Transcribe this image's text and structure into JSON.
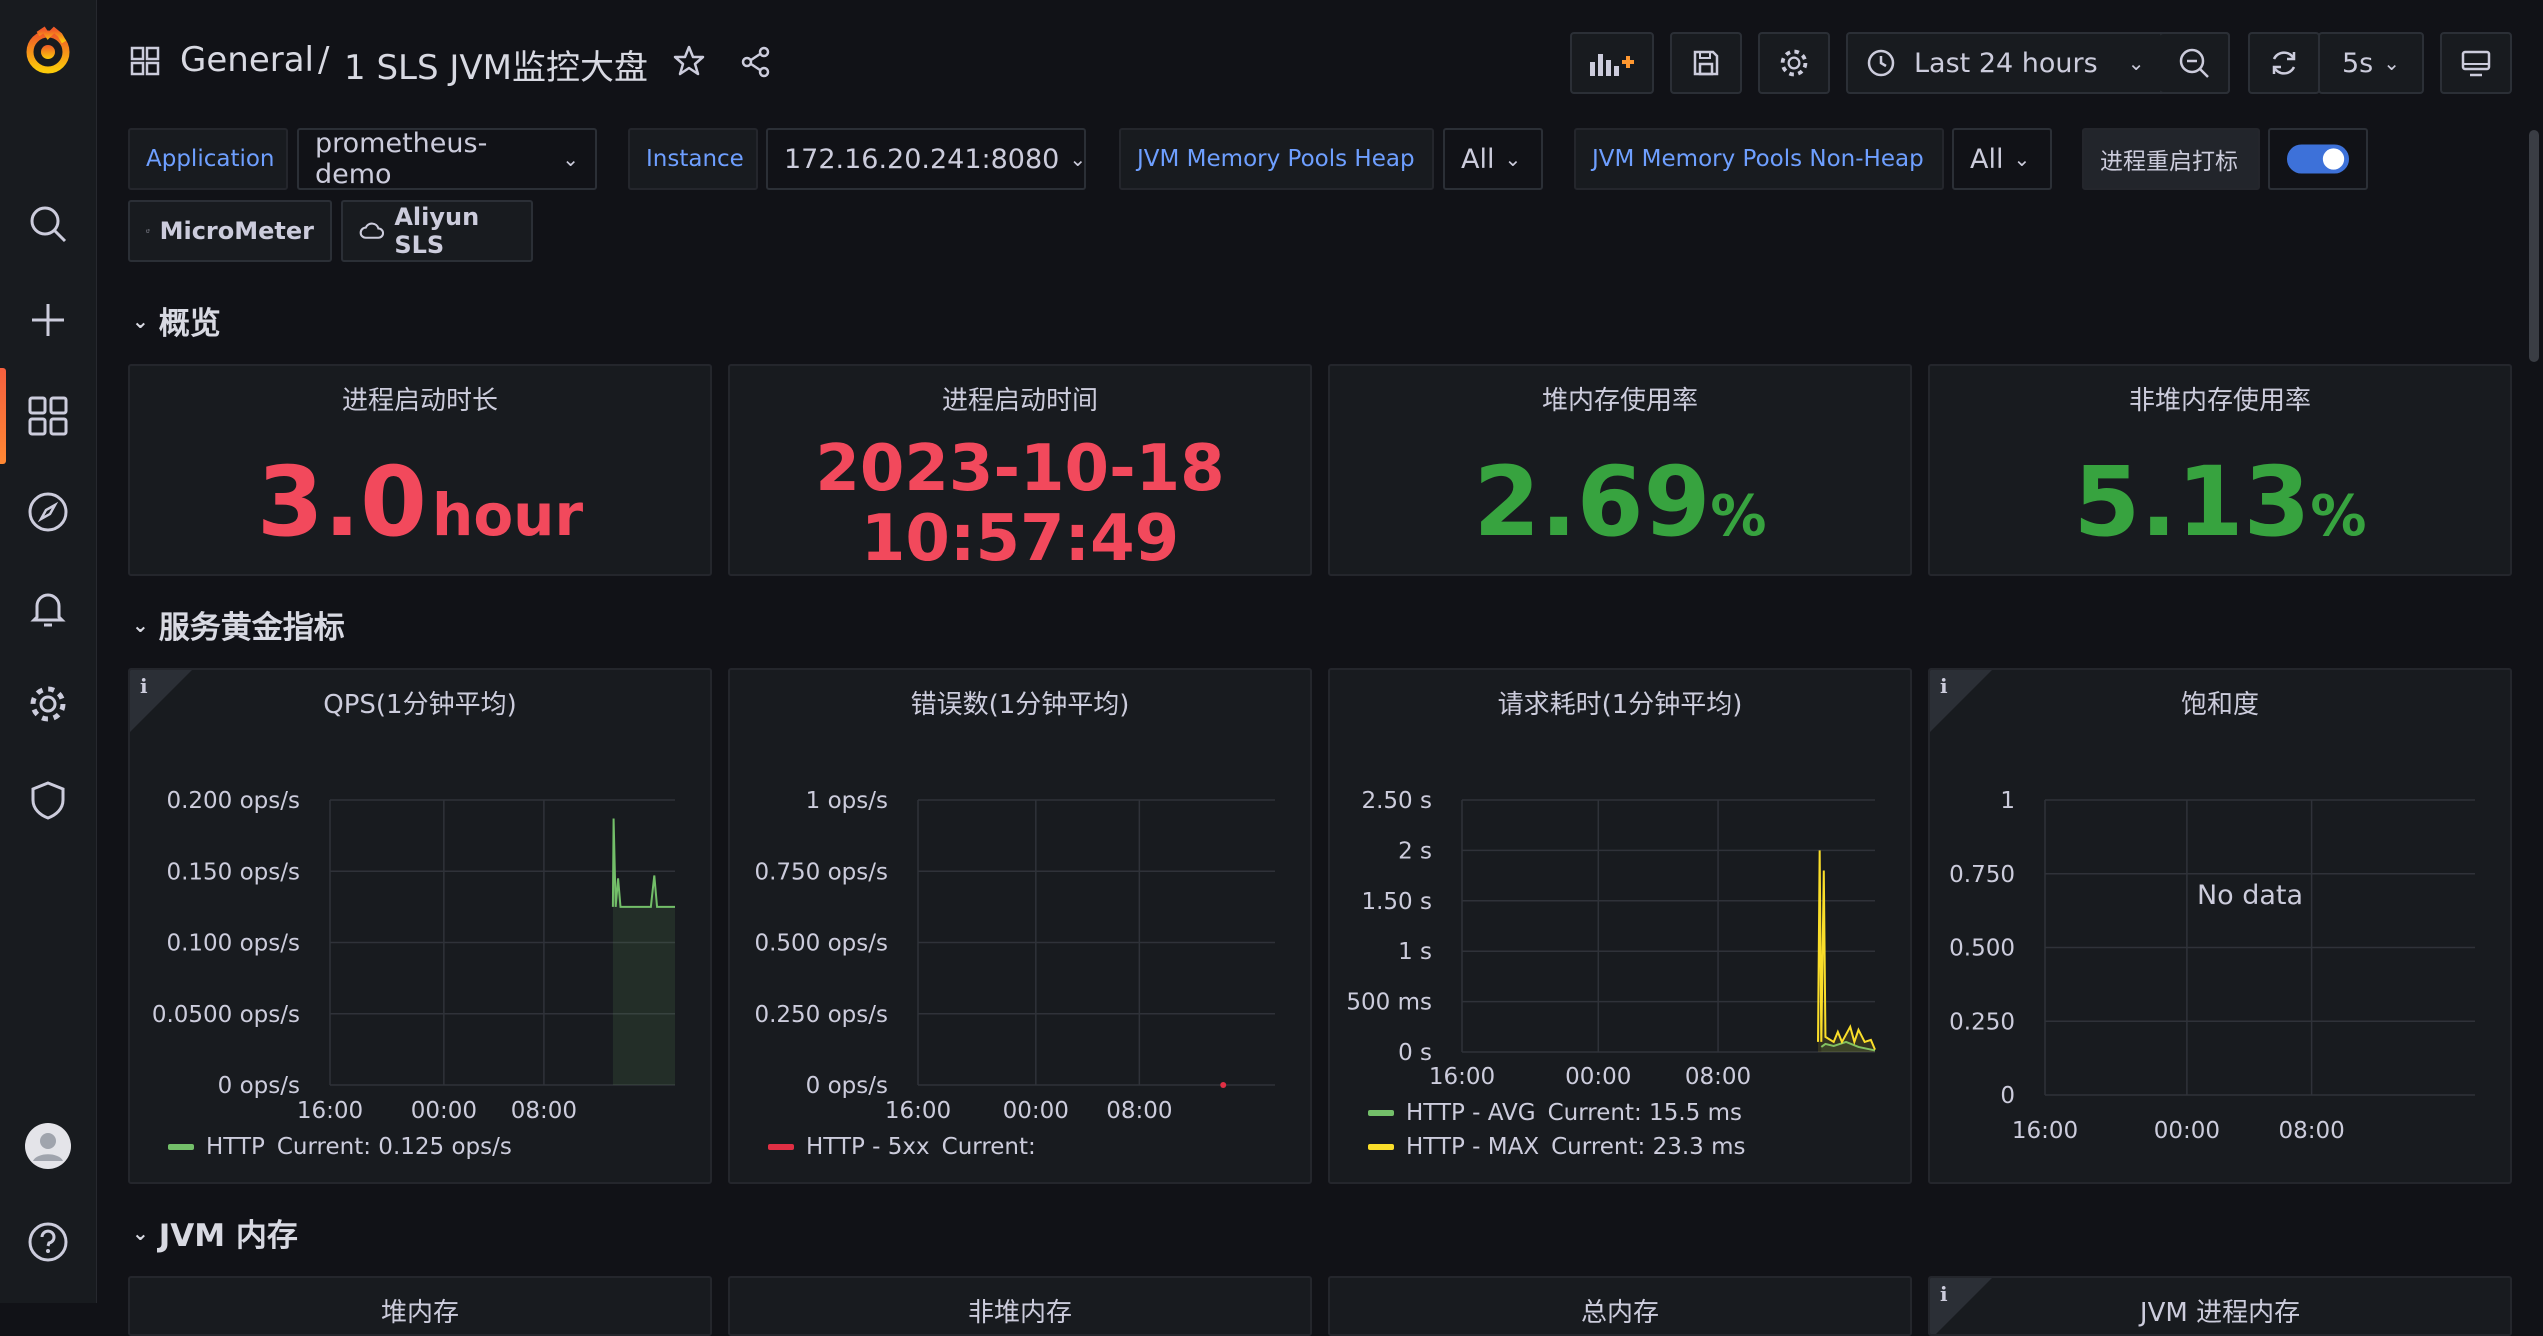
{
  "breadcrumb": {
    "folder": "General",
    "separator": "/",
    "dashboard": "1 SLS JVM监控大盘"
  },
  "toolbar": {
    "time_range": "Last 24 hours",
    "refresh_interval": "5s"
  },
  "variables": [
    {
      "label": "Application",
      "value": "prometheus-demo"
    },
    {
      "label": "Instance",
      "value": "172.16.20.241:8080"
    },
    {
      "label": "JVM Memory Pools Heap",
      "value": "All"
    },
    {
      "label": "JVM Memory Pools Non-Heap",
      "value": "All"
    },
    {
      "label": "进程重启打标",
      "toggle": true
    }
  ],
  "links": [
    {
      "label": "MicroMeter"
    },
    {
      "label": "Aliyun SLS"
    }
  ],
  "rows": {
    "overview": "概览",
    "golden": "服务黄金指标",
    "jvm_memory": "JVM 内存"
  },
  "stats": {
    "uptime": {
      "title": "进程启动时长",
      "value": "3.0",
      "unit": "hour",
      "color": "#f2495c"
    },
    "start_time": {
      "title": "进程启动时间",
      "date": "2023-10-18",
      "time": "10:57:49",
      "color": "#f2495c"
    },
    "heap_usage": {
      "title": "堆内存使用率",
      "value": "2.69",
      "unit": "%",
      "color": "#37a33f"
    },
    "nonheap_usage": {
      "title": "非堆内存使用率",
      "value": "5.13",
      "unit": "%",
      "color": "#37a33f"
    }
  },
  "panels": {
    "qps": {
      "title": "QPS(1分钟平均)",
      "legend": [
        {
          "name": "HTTP",
          "current": "Current: 0.125 ops/s",
          "color": "#73bf69"
        }
      ]
    },
    "errors": {
      "title": "错误数(1分钟平均)",
      "legend": [
        {
          "name": "HTTP - 5xx",
          "current": "Current:",
          "color": "#e02f44"
        }
      ]
    },
    "latency": {
      "title": "请求耗时(1分钟平均)",
      "legend": [
        {
          "name": "HTTP - AVG",
          "current": "Current: 15.5 ms",
          "color": "#73bf69"
        },
        {
          "name": "HTTP - MAX",
          "current": "Current: 23.3 ms",
          "color": "#fade2a"
        }
      ]
    },
    "saturation": {
      "title": "饱和度",
      "no_data": "No data"
    },
    "bottom": [
      "堆内存",
      "非堆内存",
      "总内存",
      "JVM 进程内存"
    ]
  },
  "chart_data": [
    {
      "type": "line",
      "title": "QPS(1分钟平均)",
      "x_ticks": [
        "16:00",
        "00:00",
        "08:00"
      ],
      "y_ticks": [
        "0 ops/s",
        "0.0500 ops/s",
        "0.100 ops/s",
        "0.150 ops/s",
        "0.200 ops/s"
      ],
      "ylim": [
        0,
        0.2
      ],
      "series": [
        {
          "name": "HTTP",
          "color": "#73bf69",
          "points": [
            [
              0.82,
              0.125
            ],
            [
              0.822,
              0.187
            ],
            [
              0.828,
              0.125
            ],
            [
              0.835,
              0.145
            ],
            [
              0.842,
              0.125
            ],
            [
              0.93,
              0.125
            ],
            [
              0.94,
              0.147
            ],
            [
              0.948,
              0.125
            ],
            [
              1.0,
              0.125
            ]
          ]
        }
      ]
    },
    {
      "type": "line",
      "title": "错误数(1分钟平均)",
      "x_ticks": [
        "16:00",
        "00:00",
        "08:00"
      ],
      "y_ticks": [
        "0 ops/s",
        "0.250 ops/s",
        "0.500 ops/s",
        "0.750 ops/s",
        "1 ops/s"
      ],
      "ylim": [
        0,
        1
      ],
      "series": [
        {
          "name": "HTTP - 5xx",
          "color": "#e02f44",
          "points": [
            [
              0.855,
              0.0
            ]
          ]
        }
      ]
    },
    {
      "type": "line",
      "title": "请求耗时(1分钟平均)",
      "x_ticks": [
        "16:00",
        "00:00",
        "08:00"
      ],
      "y_ticks": [
        "0 s",
        "500 ms",
        "1 s",
        "1.50 s",
        "2 s",
        "2.50 s"
      ],
      "ylim": [
        0,
        2.5
      ],
      "series": [
        {
          "name": "HTTP - AVG",
          "color": "#73bf69",
          "points": [
            [
              0.87,
              0.05
            ],
            [
              0.88,
              0.08
            ],
            [
              0.9,
              0.06
            ],
            [
              0.93,
              0.1
            ],
            [
              0.96,
              0.05
            ],
            [
              1.0,
              0.0155
            ]
          ]
        },
        {
          "name": "HTTP - MAX",
          "color": "#fade2a",
          "points": [
            [
              0.862,
              0.1
            ],
            [
              0.866,
              2.0
            ],
            [
              0.87,
              0.1
            ],
            [
              0.876,
              1.8
            ],
            [
              0.88,
              0.15
            ],
            [
              0.9,
              0.1
            ],
            [
              0.91,
              0.2
            ],
            [
              0.92,
              0.1
            ],
            [
              0.94,
              0.25
            ],
            [
              0.95,
              0.1
            ],
            [
              0.96,
              0.22
            ],
            [
              0.975,
              0.1
            ],
            [
              0.99,
              0.12
            ],
            [
              1.0,
              0.0233
            ]
          ]
        }
      ]
    },
    {
      "type": "line",
      "title": "饱和度",
      "x_ticks": [
        "16:00",
        "00:00",
        "08:00"
      ],
      "y_ticks": [
        "0",
        "0.250",
        "0.500",
        "0.750",
        "1"
      ],
      "ylim": [
        0,
        1
      ],
      "series": [],
      "no_data": "No data"
    }
  ]
}
